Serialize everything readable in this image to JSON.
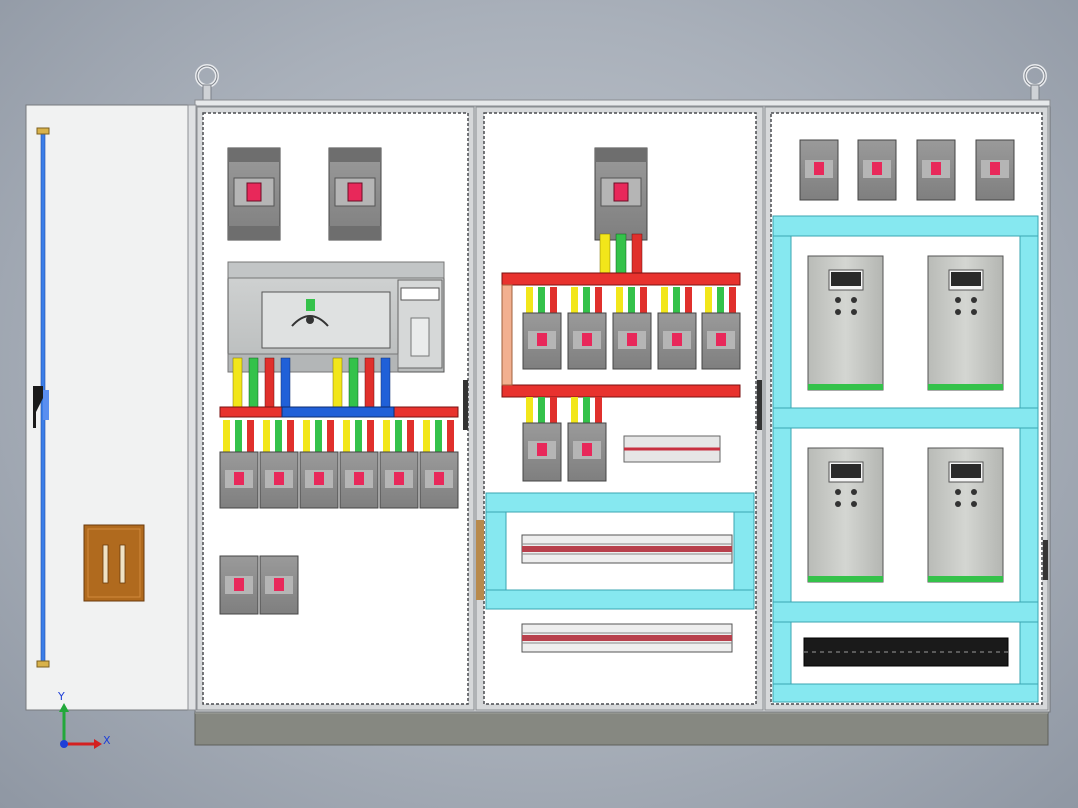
{
  "colors": {
    "cabinet_frame": "#d6d8da",
    "panel_inner": "#ffffff",
    "base_plinth": "#868881",
    "busbar_red": "#e8322e",
    "busbar_blue": "#2060d8",
    "phase_yellow": "#f2e61a",
    "phase_green": "#34c24a",
    "phase_red": "#e0302c",
    "mounting_rail": "#86e8f0",
    "breaker_body": "#8d8d8d",
    "breaker_switch": "#e8285a",
    "inverter_body": "#c9cbc7",
    "door_latch": "#b06a1e",
    "door_rod": "#3b7ee8",
    "axis_x": "#d42020",
    "axis_y": "#22a83a",
    "axis_origin": "#1e3fd8"
  },
  "axes": {
    "x_label": "X",
    "y_label": "Y"
  },
  "components": {
    "section_1": {
      "main_breakers": 2,
      "transfer_switch": 1,
      "feeder_breakers": 6,
      "spare_breakers": 2
    },
    "section_2": {
      "incoming_breaker": 1,
      "busbar_breakers": 5,
      "lower_breakers": 2,
      "terminal_strips": 3
    },
    "section_3": {
      "small_breakers": 4,
      "soft_starters": 4,
      "terminal_strip": 1
    }
  }
}
